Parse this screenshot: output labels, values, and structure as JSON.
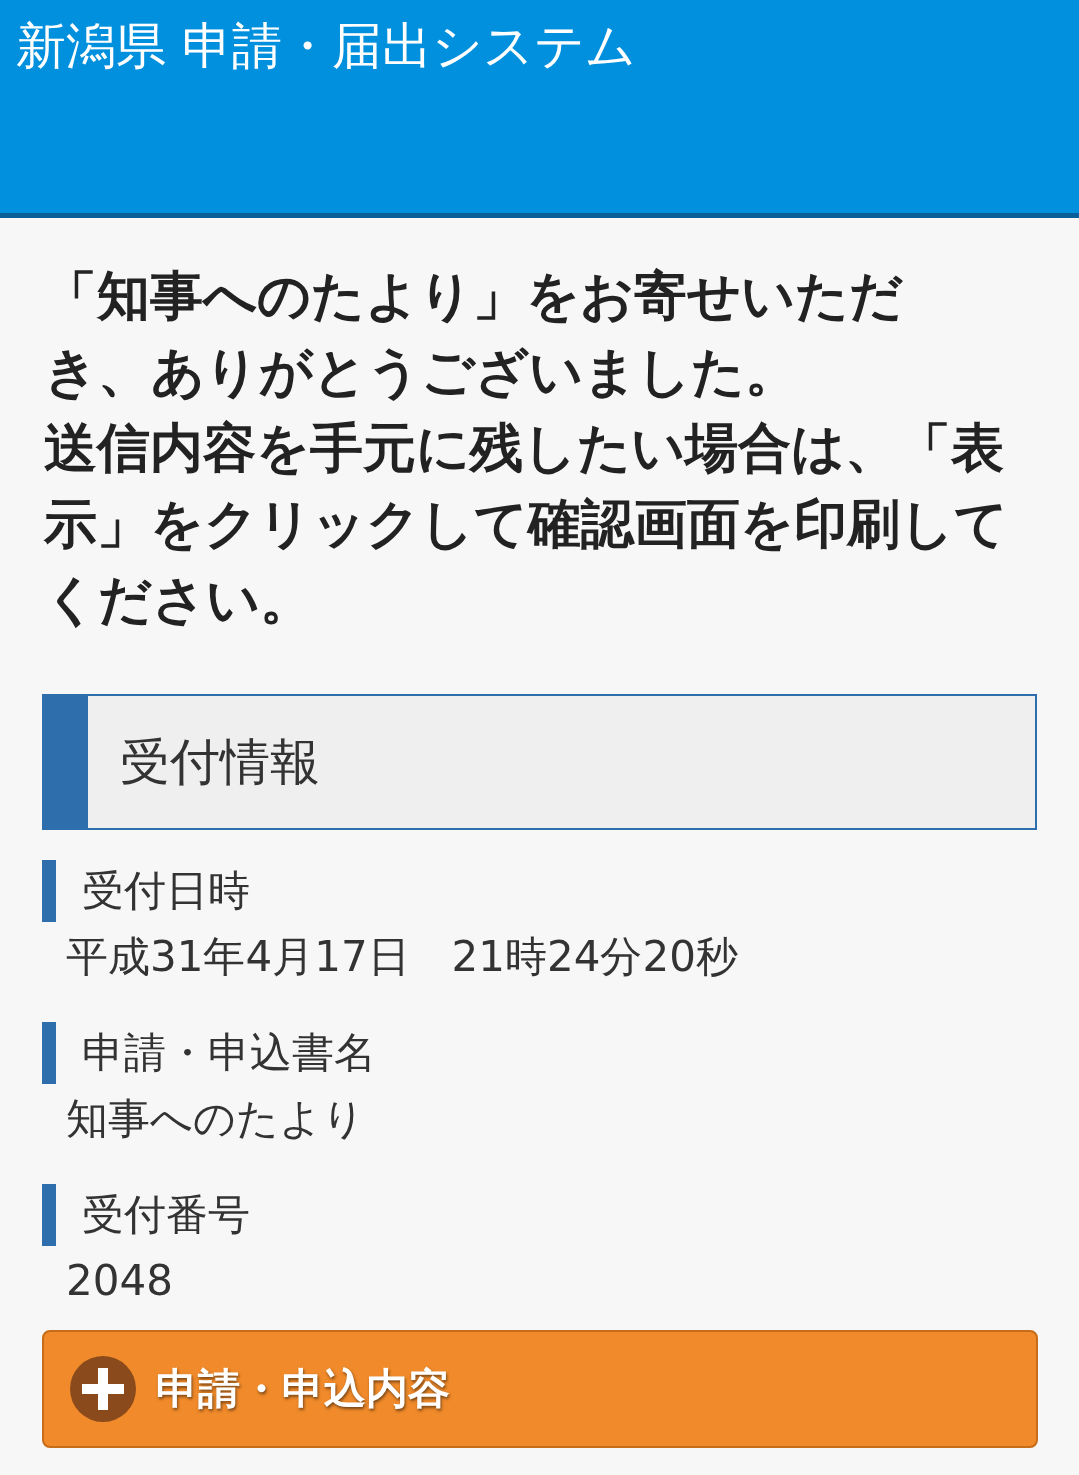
{
  "header": {
    "title": "新潟県 申請・届出システム"
  },
  "message": [
    "「知事へのたより」をお寄せいただき、ありがとうございました。",
    "送信内容を手元に残したい場合は、「表示」をクリックして確認画面を印刷してください。"
  ],
  "section": {
    "title": "受付情報"
  },
  "fields": [
    {
      "label": "受付日時",
      "value": "平成31年4月17日　21時24分20秒"
    },
    {
      "label": "申請・申込書名",
      "value": "知事へのたより"
    },
    {
      "label": "受付番号",
      "value": "2048"
    }
  ],
  "details_button": {
    "label": "申請・申込内容",
    "expanded": false
  }
}
